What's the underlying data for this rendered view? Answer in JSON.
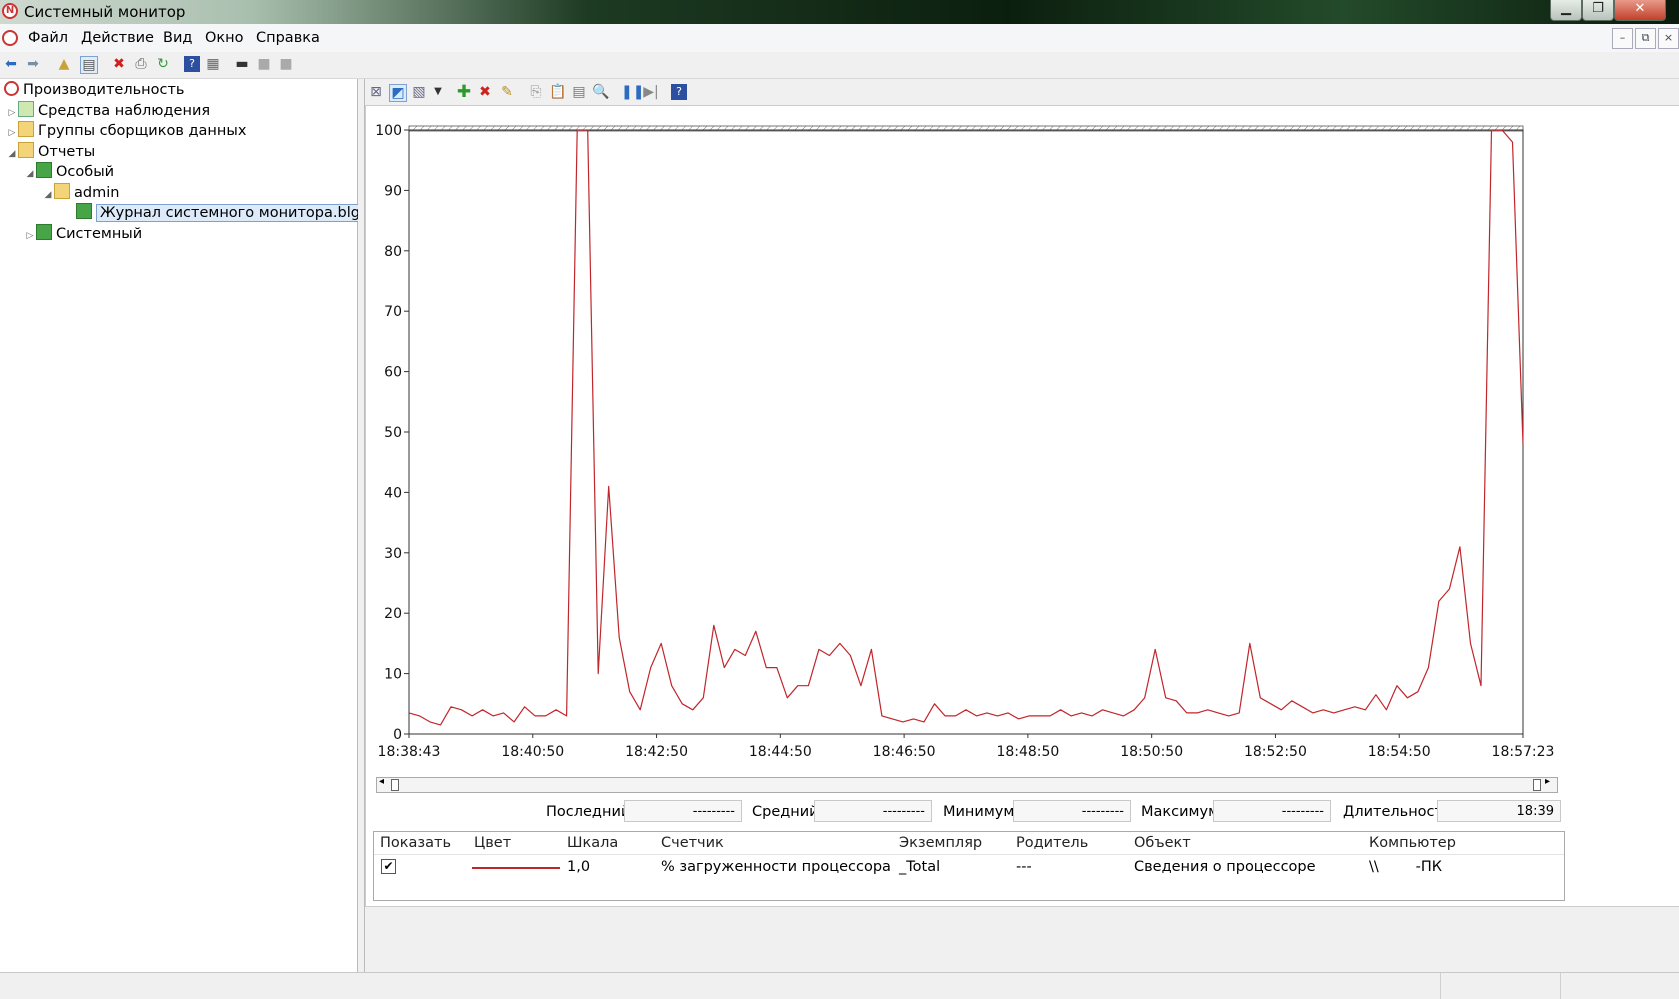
{
  "window": {
    "title": "Системный монитор"
  },
  "menu": [
    "Файл",
    "Действие",
    "Вид",
    "Окно",
    "Справка"
  ],
  "tree": {
    "root": "Производительность",
    "items": [
      {
        "label": "Средства наблюдения",
        "level": 1,
        "expander": "▷",
        "icon": "monitor-tools-icon"
      },
      {
        "label": "Группы сборщиков данных",
        "level": 1,
        "expander": "▷",
        "icon": "collector-sets-icon"
      },
      {
        "label": "Отчеты",
        "level": 1,
        "expander": "◢",
        "icon": "reports-icon"
      },
      {
        "label": "Особый",
        "level": 2,
        "expander": "◢",
        "icon": "user-defined-icon"
      },
      {
        "label": "admin",
        "level": 3,
        "expander": "◢",
        "icon": "folder-icon"
      },
      {
        "label": "Журнал системного монитора.blg",
        "level": 4,
        "expander": "",
        "icon": "log-file-icon",
        "selected": true
      },
      {
        "label": "Системный",
        "level": 2,
        "expander": "▷",
        "icon": "system-icon"
      }
    ]
  },
  "stats": {
    "last_label": "Последний",
    "last_value": "---------",
    "avg_label": "Средний",
    "avg_value": "---------",
    "min_label": "Минимум",
    "min_value": "---------",
    "max_label": "Максимум",
    "max_value": "---------",
    "duration_label": "Длительность",
    "duration_value": "18:39"
  },
  "legend": {
    "headers": [
      "Показать",
      "Цвет",
      "Шкала",
      "Счетчик",
      "Экземпляр",
      "Родитель",
      "Объект",
      "Компьютер"
    ],
    "row": {
      "show": "✔",
      "color": "#c0262b",
      "scale": "1,0",
      "counter": "% загруженности процессора",
      "instance": "_Total",
      "parent": "---",
      "object": "Сведения о процессоре",
      "computer": "\\\\        -ПК"
    }
  },
  "chart_data": {
    "type": "line",
    "ylim": [
      0,
      100
    ],
    "yticks": [
      "0",
      "10",
      "20",
      "30",
      "40",
      "50",
      "60",
      "70",
      "80",
      "90",
      "100"
    ],
    "xtick_labels": [
      "18:38:43",
      "18:40:50",
      "18:42:50",
      "18:44:50",
      "18:46:50",
      "18:48:50",
      "18:50:50",
      "18:52:50",
      "18:54:50",
      "18:57:23"
    ],
    "x_range": [
      "18:38:43",
      "18:57:23"
    ],
    "series": [
      {
        "color": "#c0262b",
        "values": [
          3.5,
          3,
          2,
          1.5,
          4.5,
          4,
          3,
          4,
          3,
          3.5,
          2,
          4.5,
          3,
          3,
          4,
          3,
          100,
          100,
          10,
          41,
          16,
          7,
          4,
          11,
          15,
          8,
          5,
          4,
          6,
          18,
          11,
          14,
          13,
          17,
          11,
          11,
          6,
          8,
          8,
          14,
          13,
          15,
          13,
          8,
          14,
          3,
          2.5,
          2,
          2.5,
          2,
          5,
          3,
          3,
          4,
          3,
          3.5,
          3,
          3.5,
          2.5,
          3,
          3,
          3,
          4,
          3,
          3.5,
          3,
          4,
          3.5,
          3,
          4,
          6,
          14,
          6,
          5.5,
          3.5,
          3.5,
          4,
          3.5,
          3,
          3.5,
          15,
          6,
          5,
          4,
          5.5,
          4.5,
          3.5,
          4,
          3.5,
          4,
          4.5,
          4,
          6.5,
          4,
          8,
          6,
          7,
          11,
          22,
          24,
          31,
          15,
          8,
          100,
          100,
          98,
          48
        ]
      }
    ]
  }
}
